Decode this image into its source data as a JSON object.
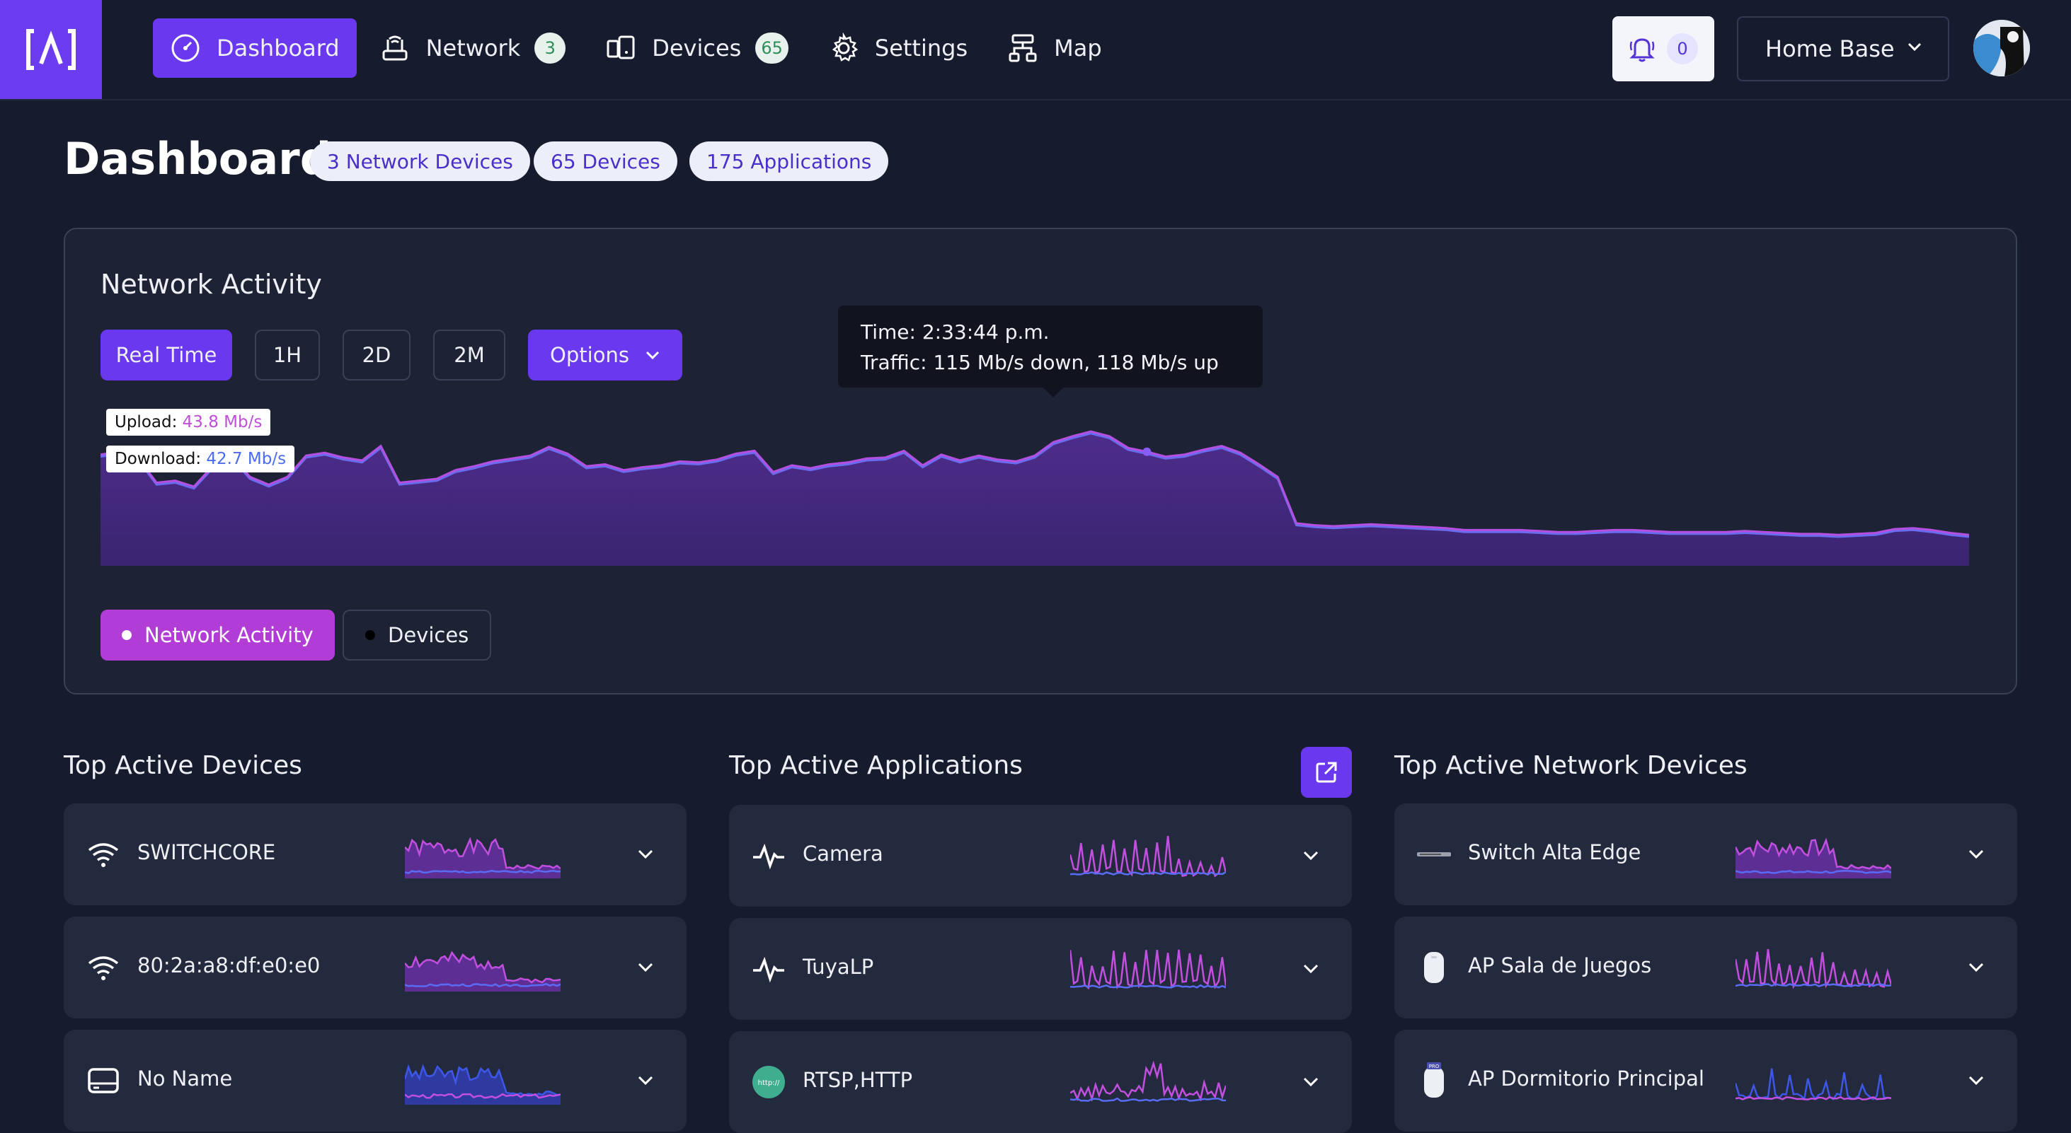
{
  "nav": {
    "items": [
      {
        "label": "Dashboard",
        "icon": "gauge-icon",
        "active": true
      },
      {
        "label": "Network",
        "icon": "router-icon",
        "badge": "3"
      },
      {
        "label": "Devices",
        "icon": "devices-icon",
        "badge": "65"
      },
      {
        "label": "Settings",
        "icon": "gear-icon"
      },
      {
        "label": "Map",
        "icon": "topology-icon"
      }
    ],
    "notifications": "0",
    "site": "Home Base"
  },
  "page": {
    "title": "Dashboard",
    "pills": [
      "3 Network Devices",
      "65 Devices",
      "175 Applications"
    ]
  },
  "activity": {
    "title": "Network Activity",
    "ranges": [
      "Real Time",
      "1H",
      "2D",
      "2M"
    ],
    "active_range": "Real Time",
    "options_label": "Options",
    "tooltip": {
      "time": "Time: 2:33:44 p.m.",
      "traffic": "Traffic: 115 Mb/s down, 118 Mb/s up"
    },
    "legend": {
      "upload_label": "Upload:",
      "upload_value": "43.8 Mb/s",
      "download_label": "Download:",
      "download_value": "42.7 Mb/s"
    },
    "toggles": [
      "Network Activity",
      "Devices"
    ],
    "colors": {
      "upload": "#b44fe0",
      "download": "#6a6cf0",
      "fill": "#4a2c86"
    }
  },
  "chart_data": {
    "type": "area",
    "series": [
      {
        "name": "Upload",
        "values": [
          115,
          118,
          112,
          86,
          88,
          82,
          103,
          114,
          92,
          84,
          92,
          114,
          117,
          112,
          109,
          124,
          86,
          88,
          90,
          99,
          103,
          108,
          111,
          114,
          123,
          116,
          103,
          105,
          99,
          102,
          104,
          108,
          107,
          110,
          116,
          119,
          97,
          104,
          101,
          105,
          107,
          111,
          112,
          119,
          104,
          115,
          109,
          114,
          110,
          108,
          114,
          128,
          134,
          139,
          134,
          122,
          118,
          113,
          115,
          120,
          124,
          117,
          105,
          92,
          44,
          42,
          41,
          42,
          43,
          42,
          41,
          40,
          39,
          37,
          37,
          37,
          37,
          36,
          35,
          35,
          36,
          37,
          37,
          36,
          35,
          35,
          35,
          35,
          36,
          35,
          34,
          33,
          33,
          32,
          33,
          34,
          38,
          39,
          37,
          34,
          32
        ]
      },
      {
        "name": "Download",
        "values": [
          113,
          116,
          110,
          84,
          86,
          80,
          101,
          112,
          90,
          82,
          90,
          112,
          115,
          110,
          107,
          122,
          84,
          86,
          88,
          97,
          101,
          106,
          109,
          112,
          121,
          114,
          101,
          103,
          97,
          100,
          102,
          106,
          105,
          108,
          114,
          117,
          95,
          102,
          99,
          103,
          105,
          109,
          110,
          117,
          102,
          113,
          107,
          112,
          108,
          106,
          112,
          126,
          132,
          137,
          132,
          120,
          116,
          111,
          113,
          118,
          122,
          115,
          103,
          90,
          42,
          40,
          39,
          40,
          41,
          40,
          39,
          38,
          37,
          35,
          35,
          35,
          35,
          34,
          33,
          33,
          34,
          35,
          35,
          34,
          33,
          33,
          33,
          33,
          34,
          33,
          32,
          31,
          31,
          30,
          31,
          32,
          36,
          37,
          35,
          32,
          30
        ]
      }
    ]
  },
  "top_devices": {
    "title": "Top Active Devices",
    "rows": [
      {
        "label": "SWITCHCORE",
        "icon": "wifi-icon"
      },
      {
        "label": "80:2a:a8:df:e0:e0",
        "icon": "wifi-icon"
      },
      {
        "label": "No Name",
        "icon": "drive-icon"
      }
    ]
  },
  "top_apps": {
    "title": "Top Active Applications",
    "rows": [
      {
        "label": "Camera",
        "icon": "pulse-icon"
      },
      {
        "label": "TuyaLP",
        "icon": "pulse-icon"
      },
      {
        "label": "RTSP,HTTP",
        "icon": "http-icon",
        "icon_text": "http://"
      }
    ]
  },
  "top_network": {
    "title": "Top Active Network Devices",
    "rows": [
      {
        "label": "Switch Alta Edge",
        "icon": "switch-device-icon"
      },
      {
        "label": "AP Sala de Juegos",
        "icon": "access-point-icon"
      },
      {
        "label": "AP Dormitorio Principal",
        "icon": "access-point-pro-icon",
        "icon_text": "PRO"
      }
    ]
  }
}
